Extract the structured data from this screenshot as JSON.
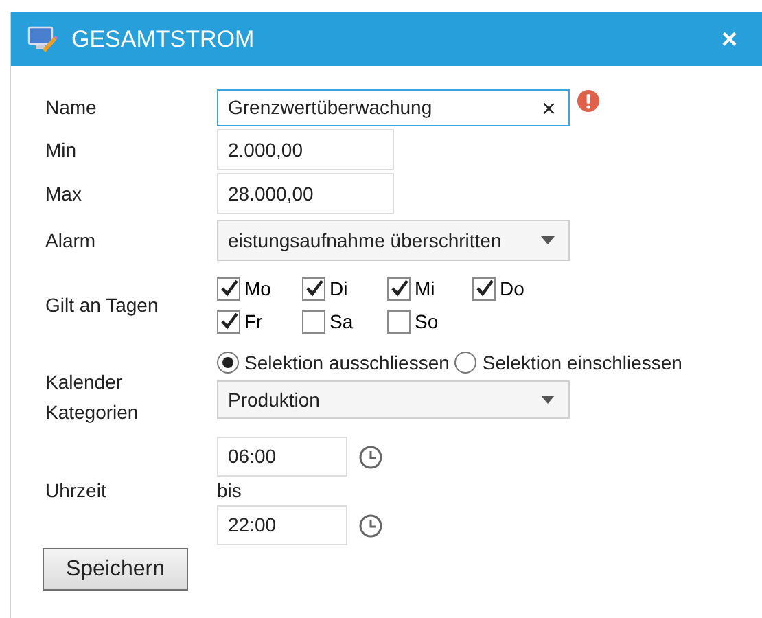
{
  "window": {
    "title": "GESAMTSTROM",
    "close": "×"
  },
  "name": {
    "label": "Name",
    "value": "Grenzwertüberwachung",
    "clear": "×",
    "error": true
  },
  "min": {
    "label": "Min",
    "value": "2.000,00"
  },
  "max": {
    "label": "Max",
    "value": "28.000,00"
  },
  "alarm": {
    "label": "Alarm",
    "value": "eistungsaufnahme überschritten"
  },
  "days": {
    "label": "Gilt an Tagen",
    "items": [
      {
        "label": "Mo",
        "checked": true
      },
      {
        "label": "Di",
        "checked": true
      },
      {
        "label": "Mi",
        "checked": true
      },
      {
        "label": "Do",
        "checked": true
      },
      {
        "label": "Fr",
        "checked": true
      },
      {
        "label": "Sa",
        "checked": false
      },
      {
        "label": "So",
        "checked": false
      }
    ]
  },
  "calendar": {
    "label": "Kalender Kategorien",
    "options": [
      {
        "label": "Selektion ausschliessen",
        "selected": true
      },
      {
        "label": "Selektion einschliessen",
        "selected": false
      }
    ],
    "value": "Produktion"
  },
  "time": {
    "label": "Uhrzeit",
    "from": "06:00",
    "separator": "bis",
    "to": "22:00"
  },
  "save": "Speichern"
}
